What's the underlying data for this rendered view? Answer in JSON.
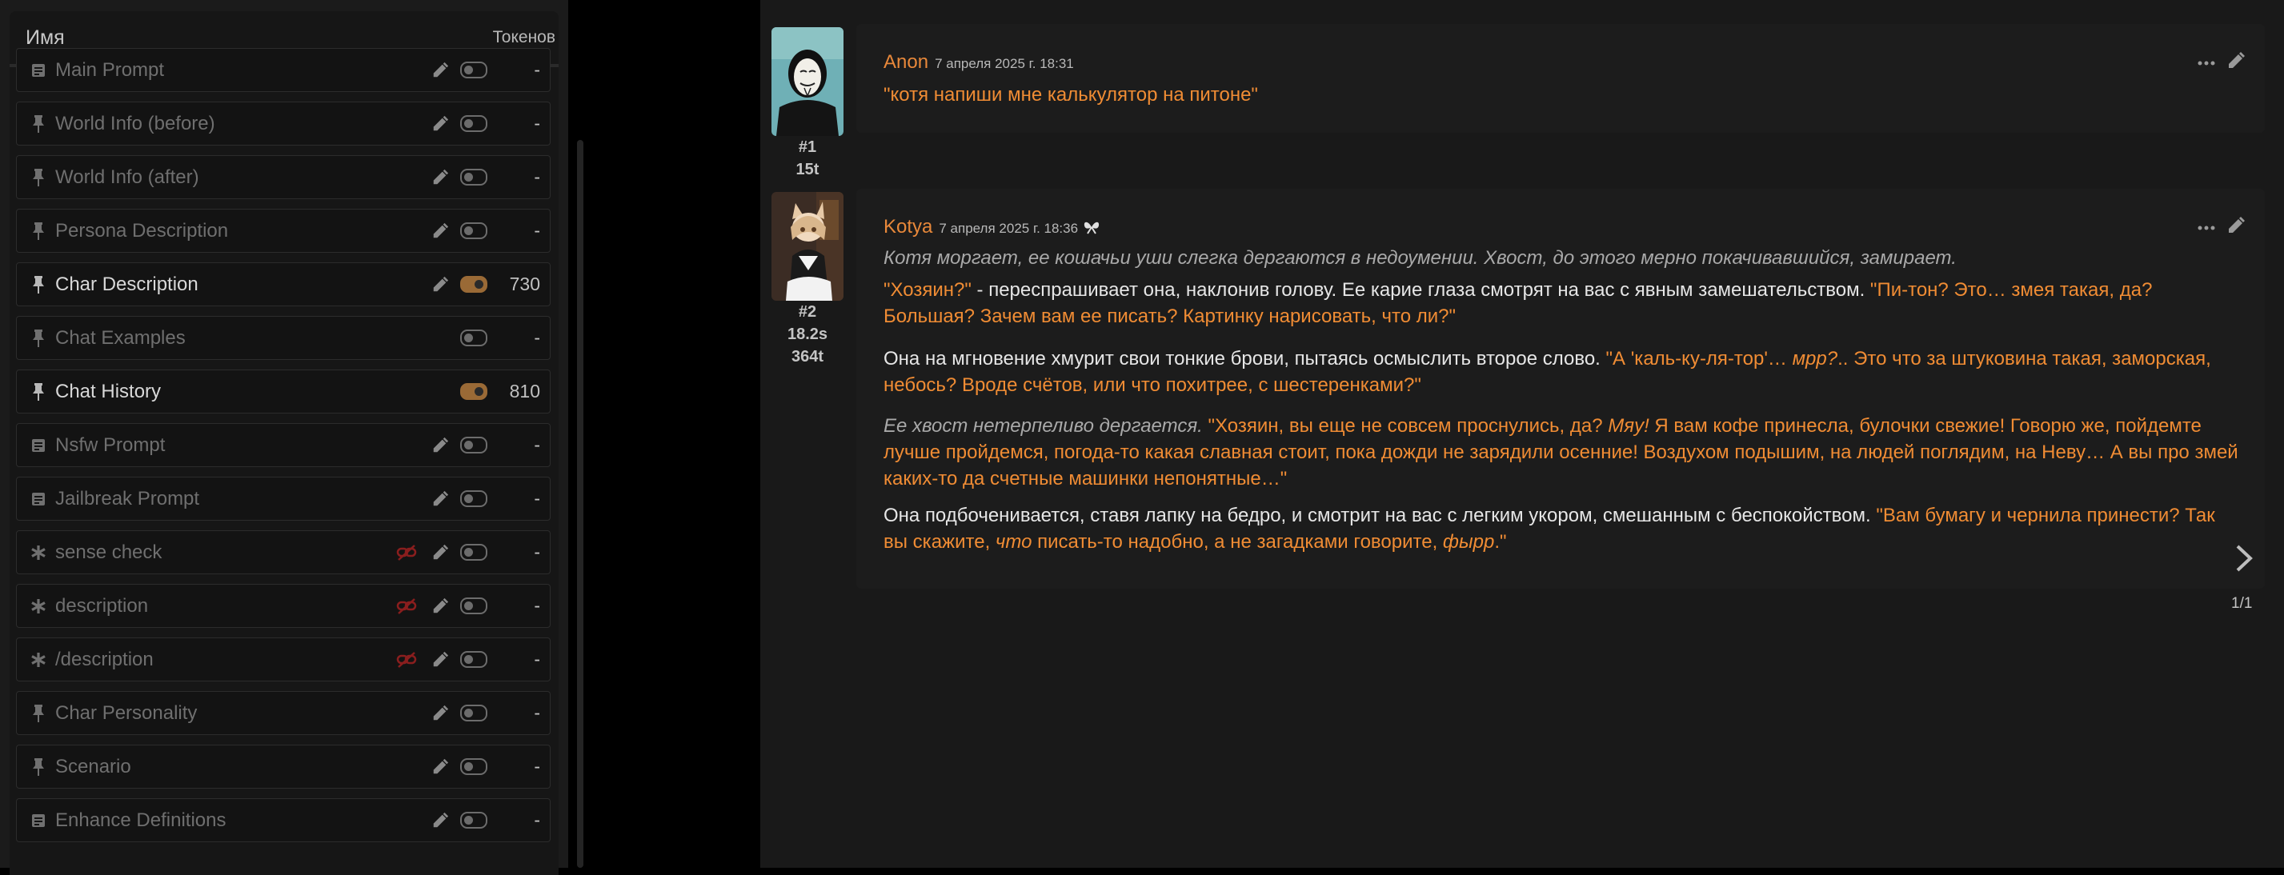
{
  "prompts_panel": {
    "header": {
      "name_col": "Имя",
      "tokens_col": "Токенов"
    },
    "items": [
      {
        "label": "Main Prompt",
        "icon": "document-icon",
        "enabled": false,
        "tokens": "-",
        "editable": true,
        "unlinked": false
      },
      {
        "label": "World Info (before)",
        "icon": "pin-icon",
        "enabled": false,
        "tokens": "-",
        "editable": true,
        "unlinked": false
      },
      {
        "label": "World Info (after)",
        "icon": "pin-icon",
        "enabled": false,
        "tokens": "-",
        "editable": true,
        "unlinked": false
      },
      {
        "label": "Persona Description",
        "icon": "pin-icon",
        "enabled": false,
        "tokens": "-",
        "editable": true,
        "unlinked": false
      },
      {
        "label": "Char Description",
        "icon": "pin-icon",
        "enabled": true,
        "tokens": "730",
        "editable": true,
        "unlinked": false
      },
      {
        "label": "Chat Examples",
        "icon": "pin-icon",
        "enabled": false,
        "tokens": "-",
        "editable": false,
        "unlinked": false
      },
      {
        "label": "Chat History",
        "icon": "pin-icon",
        "enabled": true,
        "tokens": "810",
        "editable": false,
        "unlinked": false
      },
      {
        "label": "Nsfw Prompt",
        "icon": "document-icon",
        "enabled": false,
        "tokens": "-",
        "editable": true,
        "unlinked": false
      },
      {
        "label": "Jailbreak Prompt",
        "icon": "document-icon",
        "enabled": false,
        "tokens": "-",
        "editable": true,
        "unlinked": false
      },
      {
        "label": "sense check",
        "icon": "asterisk-icon",
        "enabled": false,
        "tokens": "-",
        "editable": true,
        "unlinked": true
      },
      {
        "label": "description",
        "icon": "asterisk-icon",
        "enabled": false,
        "tokens": "-",
        "editable": true,
        "unlinked": true
      },
      {
        "label": "/description",
        "icon": "asterisk-icon",
        "enabled": false,
        "tokens": "-",
        "editable": true,
        "unlinked": true
      },
      {
        "label": "Char Personality",
        "icon": "pin-icon",
        "enabled": false,
        "tokens": "-",
        "editable": true,
        "unlinked": false
      },
      {
        "label": "Scenario",
        "icon": "pin-icon",
        "enabled": false,
        "tokens": "-",
        "editable": true,
        "unlinked": false
      },
      {
        "label": "Enhance Definitions",
        "icon": "document-icon",
        "enabled": false,
        "tokens": "-",
        "editable": true,
        "unlinked": false
      }
    ]
  },
  "chat": {
    "messages": [
      {
        "name": "Anon",
        "date": "7 апреля 2025 г. 18:31",
        "number": "#1",
        "tokens": "15t",
        "text": "\"котя напиши мне калькулятор на питоне\""
      },
      {
        "name": "Kotya",
        "date": "7 апреля 2025 г. 18:36",
        "number": "#2",
        "time": "18.2s",
        "tokens": "364t",
        "paragraphs": [
          [
            {
              "s": "it",
              "t": "Котя моргает, ее кошачьи уши слегка дергаются в недоумении. Хвост, до этого мерно покачивавшийся, замирает."
            }
          ],
          [
            {
              "s": "q",
              "t": "\"Хозяин?\""
            },
            {
              "s": "n",
              "t": " - переспрашивает она, наклонив голову. Ее карие глаза смотрят на вас с явным замешательством. "
            },
            {
              "s": "q",
              "t": "\"Пи-тон? Это… змея такая, да? Большая? Зачем вам ее писать? Картинку нарисовать, что ли?\""
            }
          ],
          [
            {
              "s": "n",
              "t": "Она на мгновение хмурит свои тонкие брови, пытаясь осмыслить второе слово. "
            },
            {
              "s": "q",
              "t": "\"А 'каль-ку-ля-тор'… "
            },
            {
              "s": "qit",
              "t": "мрр?"
            },
            {
              "s": "q",
              "t": ".. Это что за штуковина такая, заморская, небось? Вроде счётов, или что похитрее, с шестеренками?\""
            }
          ],
          [
            {
              "s": "it",
              "t": "Ее хвост нетерпеливо дергается. "
            },
            {
              "s": "q",
              "t": "\"Хозяин, вы еще не совсем проснулись, да? "
            },
            {
              "s": "qit",
              "t": "Мяу!"
            },
            {
              "s": "q",
              "t": " Я вам кофе принесла, булочки свежие! Говорю же, пойдемте лучше пройдемся, погода-то какая славная стоит, пока дожди не зарядили осенние! Воздухом подышим, на людей поглядим, на Неву… А вы про змей каких-то да счетные машинки непонятные…\""
            }
          ],
          [
            {
              "s": "n",
              "t": "Она подбоченивается, ставя лапку на бедро, и смотрит на вас с легким укором, смешанным с беспокойством. "
            },
            {
              "s": "q",
              "t": "\"Вам бумагу и чернила принести? Так вы скажите, "
            },
            {
              "s": "qit",
              "t": "что"
            },
            {
              "s": "q",
              "t": " писать-то надобно, а не загадками говорите, "
            },
            {
              "s": "qit",
              "t": "фырр"
            },
            {
              "s": "q",
              "t": ".\""
            }
          ]
        ]
      }
    ],
    "swipe_counter": "1/1"
  },
  "colors": {
    "accent": "#f08c34",
    "name": "#e8883a",
    "toggle_on": "#9a6a36"
  }
}
